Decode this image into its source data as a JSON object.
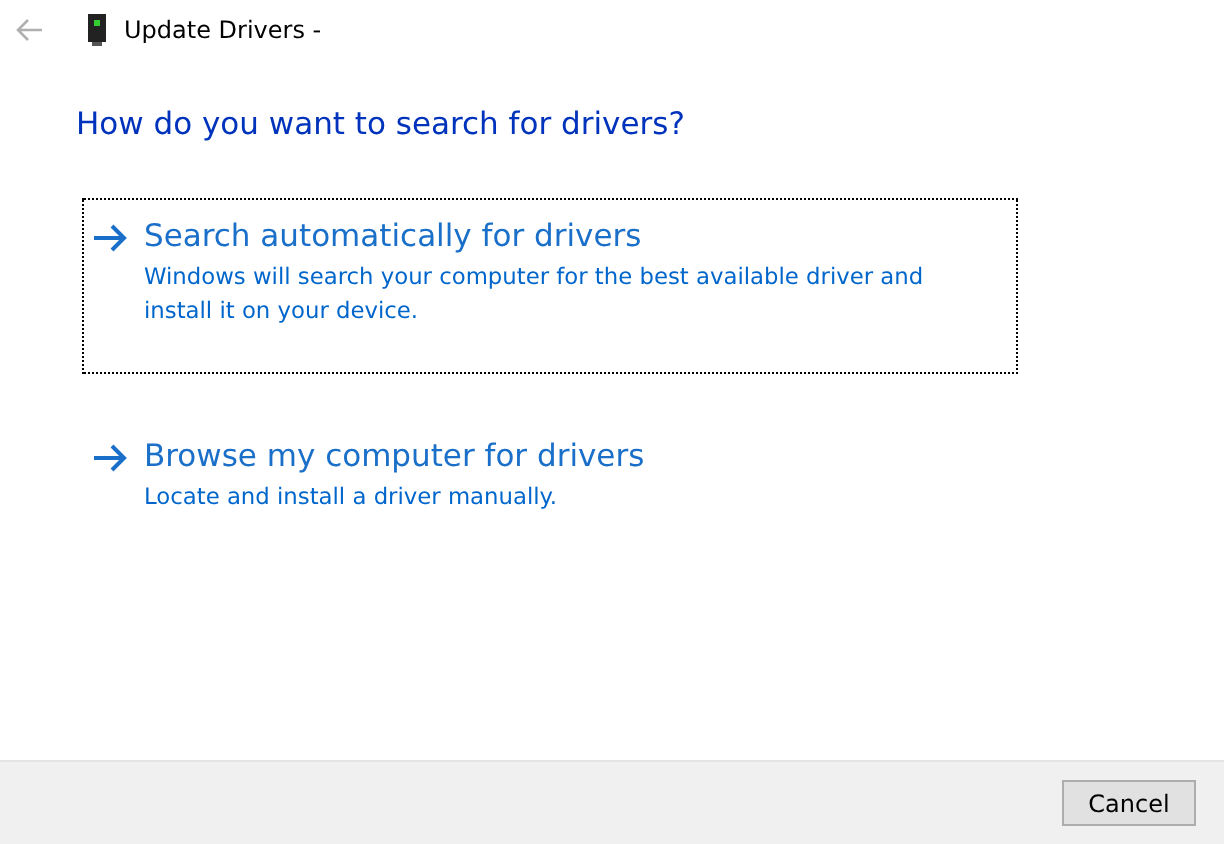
{
  "window": {
    "title": "Update Drivers -"
  },
  "heading": "How do you want to search for drivers?",
  "options": [
    {
      "title": "Search automatically for drivers",
      "description": "Windows will search your computer for the best available driver and install it on your device.",
      "focused": true
    },
    {
      "title": "Browse my computer for drivers",
      "description": "Locate and install a driver manually.",
      "focused": false
    }
  ],
  "buttons": [
    "Cancel"
  ]
}
